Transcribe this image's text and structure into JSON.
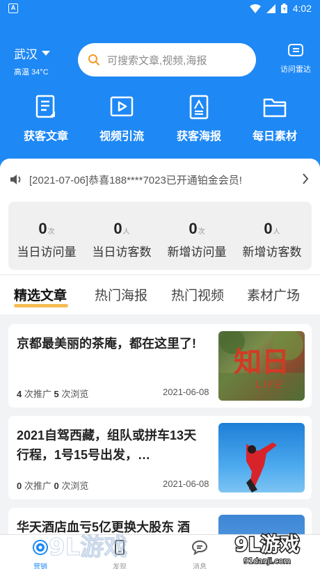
{
  "statusbar": {
    "app_badge": "A",
    "time": "4:02"
  },
  "location": {
    "city": "武汉",
    "weather": "高温 34°C"
  },
  "search": {
    "placeholder": "可搜索文章,视频,海报"
  },
  "radar": {
    "label": "访问雷达"
  },
  "quick_actions": [
    {
      "label": "获客文章",
      "icon": "article-icon"
    },
    {
      "label": "视频引流",
      "icon": "video-icon"
    },
    {
      "label": "获客海报",
      "icon": "poster-icon"
    },
    {
      "label": "每日素材",
      "icon": "folder-icon"
    }
  ],
  "notice": {
    "text": "[2021-07-06]恭喜188****7023已开通铂金会员!"
  },
  "stats": [
    {
      "value": "0",
      "unit": "次",
      "label": "当日访问量"
    },
    {
      "value": "0",
      "unit": "人",
      "label": "当日访客数"
    },
    {
      "value": "0",
      "unit": "次",
      "label": "新增访问量"
    },
    {
      "value": "0",
      "unit": "人",
      "label": "新增访客数"
    }
  ],
  "tabs": [
    "精选文章",
    "热门海报",
    "热门视频",
    "素材广场"
  ],
  "articles": [
    {
      "title": "京都最美丽的茶庵，都在这里了!",
      "promo_count": "4",
      "promo_label": "次推广",
      "view_count": "5",
      "view_label": "次浏览",
      "date": "2021-06-08",
      "thumb_text": "知日",
      "thumb_sub": "LIFE"
    },
    {
      "title": "2021自驾西藏，组队或拼车13天行程，1号15号出发，…",
      "promo_count": "0",
      "promo_label": "次推广",
      "view_count": "0",
      "view_label": "次浏览",
      "date": "2021-06-08"
    },
    {
      "title": "华天酒店血亏5亿更换大股东 酒"
    }
  ],
  "bottom_nav": [
    {
      "label": "营销",
      "active": true
    },
    {
      "label": "发现",
      "active": false
    },
    {
      "label": "消息",
      "active": false
    }
  ],
  "watermark": {
    "logo": "9L游戏",
    "url": "91danji.com"
  },
  "colors": {
    "primary": "#1e88f5",
    "accent": "#f5b542",
    "background": "#f2f3f5"
  }
}
